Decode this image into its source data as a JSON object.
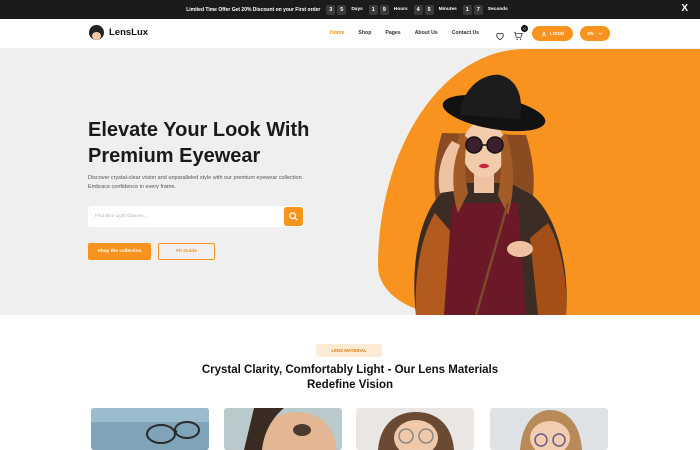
{
  "announcement": {
    "message": "Limited Time Offer Get 20% Discount on your First order",
    "countdown": [
      {
        "digits": [
          "3",
          "5"
        ],
        "unit": "Days"
      },
      {
        "digits": [
          "1",
          "9"
        ],
        "unit": "Hours"
      },
      {
        "digits": [
          "4",
          "5"
        ],
        "unit": "Minutes"
      },
      {
        "digits": [
          "1",
          "7"
        ],
        "unit": "Seconds"
      }
    ],
    "close_label": "X"
  },
  "header": {
    "logo_text": "LensLux",
    "nav": [
      "Home",
      "Shop",
      "Pages",
      "About Us",
      "Contact Us"
    ],
    "active_nav": "Home",
    "cart_count": "0",
    "login_label": "LOGIN",
    "lang_label": "EN",
    "icons": [
      "heart-icon",
      "cart-icon",
      "user-icon",
      "chevron-down-icon"
    ]
  },
  "hero": {
    "title": "Elevate Your Look With Premium Eyewear",
    "description": "Discover crystal-clear vision and unparalleled style with our premium eyewear collection. Embrace confidence in every frame.",
    "search_placeholder": "Find Blue Light Glasses...",
    "primary_cta": "Shop the collection",
    "secondary_cta": "Fit Guide"
  },
  "lens_section": {
    "pill": "LENS MATERIAL",
    "title": "Crystal Clarity, Comfortably Light - Our Lens Materials Redefine Vision"
  },
  "colors": {
    "accent": "#f7931e",
    "dark": "#1b1b1b",
    "hero_bg": "#efefef"
  }
}
